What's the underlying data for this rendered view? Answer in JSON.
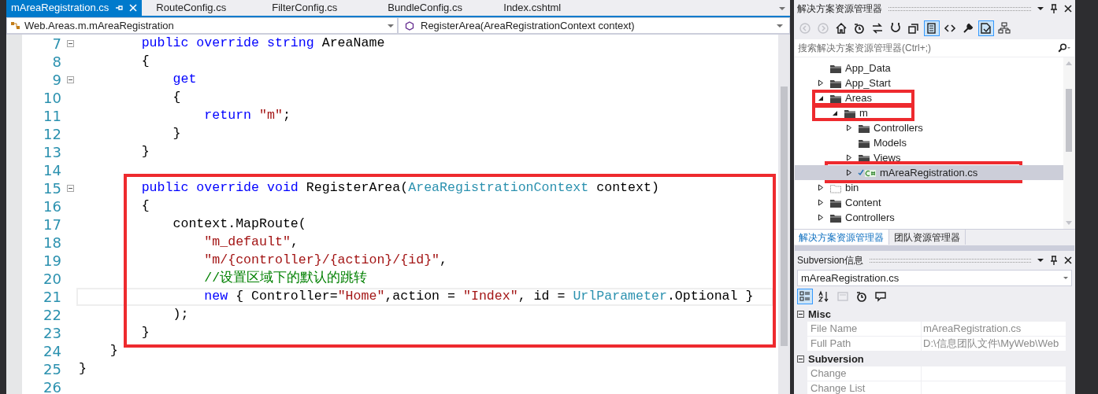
{
  "editor": {
    "tabs": [
      {
        "label": "mAreaRegistration.cs",
        "selected": true
      },
      {
        "label": "RouteConfig.cs",
        "selected": false
      },
      {
        "label": "FilterConfig.cs",
        "selected": false
      },
      {
        "label": "BundleConfig.cs",
        "selected": false
      },
      {
        "label": "Index.cshtml",
        "selected": false
      }
    ],
    "type_dropdown": "Web.Areas.m.mAreaRegistration",
    "member_dropdown": "RegisterArea(AreaRegistrationContext context)",
    "blocks": [
      {
        "highlighted": false,
        "lines": [
          {
            "number": "7",
            "fold": true,
            "current": false,
            "tokens": [
              {
                "kind": "keyword",
                "text": "        public override string "
              },
              {
                "kind": "plain",
                "text": "AreaName"
              }
            ]
          },
          {
            "number": "8",
            "fold": false,
            "current": false,
            "tokens": [
              {
                "kind": "plain",
                "text": "        {"
              }
            ]
          },
          {
            "number": "9",
            "fold": true,
            "current": false,
            "tokens": [
              {
                "kind": "keyword",
                "text": "            get"
              }
            ]
          },
          {
            "number": "10",
            "fold": false,
            "current": false,
            "tokens": [
              {
                "kind": "plain",
                "text": "            {"
              }
            ]
          },
          {
            "number": "11",
            "fold": false,
            "current": false,
            "tokens": [
              {
                "kind": "keyword",
                "text": "                return "
              },
              {
                "kind": "string",
                "text": "\"m\""
              },
              {
                "kind": "plain",
                "text": ";"
              }
            ]
          },
          {
            "number": "12",
            "fold": false,
            "current": false,
            "tokens": [
              {
                "kind": "plain",
                "text": "            }"
              }
            ]
          },
          {
            "number": "13",
            "fold": false,
            "current": false,
            "tokens": [
              {
                "kind": "plain",
                "text": "        }"
              }
            ]
          },
          {
            "number": "14",
            "fold": false,
            "current": false
          }
        ]
      },
      {
        "highlighted": true,
        "lines": [
          {
            "number": "15",
            "fold": true,
            "current": false,
            "tokens": [
              {
                "kind": "keyword",
                "text": "        public override void "
              },
              {
                "kind": "plain",
                "text": "RegisterArea("
              },
              {
                "kind": "type",
                "text": "AreaRegistrationContext"
              },
              {
                "kind": "plain",
                "text": " context)"
              }
            ]
          },
          {
            "number": "16",
            "fold": false,
            "current": false,
            "tokens": [
              {
                "kind": "plain",
                "text": "        {"
              }
            ]
          },
          {
            "number": "17",
            "fold": false,
            "current": false,
            "tokens": [
              {
                "kind": "plain",
                "text": "            context.MapRoute("
              }
            ]
          },
          {
            "number": "18",
            "fold": false,
            "current": false,
            "tokens": [
              {
                "kind": "string",
                "text": "                \"m_default\""
              },
              {
                "kind": "plain",
                "text": ","
              }
            ]
          },
          {
            "number": "19",
            "fold": false,
            "current": false,
            "tokens": [
              {
                "kind": "string",
                "text": "                \"m/{controller}/{action}/{id}\""
              },
              {
                "kind": "plain",
                "text": ","
              }
            ]
          },
          {
            "number": "20",
            "fold": false,
            "current": false,
            "tokens": [
              {
                "kind": "comment",
                "text": "                //设置区域下的默认的跳转"
              }
            ]
          },
          {
            "number": "21",
            "fold": false,
            "current": true,
            "tokens": [
              {
                "kind": "keyword",
                "text": "                new"
              },
              {
                "kind": "plain",
                "text": " { Controller="
              },
              {
                "kind": "string",
                "text": "\"Home\""
              },
              {
                "kind": "plain",
                "text": ",action = "
              },
              {
                "kind": "string",
                "text": "\"Index\""
              },
              {
                "kind": "plain",
                "text": ", id = "
              },
              {
                "kind": "type",
                "text": "UrlParameter"
              },
              {
                "kind": "plain",
                "text": ".Optional }"
              }
            ]
          },
          {
            "number": "22",
            "fold": false,
            "current": false,
            "tokens": [
              {
                "kind": "plain",
                "text": "            );"
              }
            ]
          },
          {
            "number": "23",
            "fold": false,
            "current": false,
            "tokens": [
              {
                "kind": "plain",
                "text": "        }"
              }
            ]
          }
        ]
      },
      {
        "highlighted": false,
        "lines": [
          {
            "number": "24",
            "fold": false,
            "current": false,
            "tokens": [
              {
                "kind": "plain",
                "text": "    }"
              }
            ]
          },
          {
            "number": "25",
            "fold": false,
            "current": false,
            "tokens": [
              {
                "kind": "plain",
                "text": "}"
              }
            ]
          },
          {
            "number": "26",
            "fold": false,
            "current": false
          }
        ]
      }
    ]
  },
  "solution_explorer": {
    "title": "解决方案资源管理器",
    "toolbar": [
      {
        "kind": "back",
        "disabled": true,
        "pressed": false
      },
      {
        "kind": "forward",
        "disabled": true,
        "pressed": false
      },
      {
        "kind": "home",
        "disabled": false,
        "pressed": false
      },
      {
        "kind": "history",
        "disabled": false,
        "pressed": false
      },
      {
        "kind": "sync",
        "disabled": false,
        "pressed": false
      },
      {
        "kind": "refresh",
        "disabled": false,
        "pressed": false
      },
      {
        "kind": "collapse",
        "disabled": false,
        "pressed": false
      },
      {
        "kind": "show-all",
        "disabled": false,
        "pressed": true
      },
      {
        "kind": "code",
        "disabled": false,
        "pressed": false
      },
      {
        "kind": "properties",
        "disabled": false,
        "pressed": false
      },
      {
        "kind": "preview",
        "disabled": false,
        "pressed": true
      },
      {
        "kind": "diagram",
        "disabled": false,
        "pressed": false
      }
    ],
    "search": {
      "placeholder": "搜索解决方案资源管理器(Ctrl+;)"
    },
    "tree": [
      {
        "label": "App_Data",
        "kind": "folder",
        "highlighted": false,
        "selected": false
      },
      {
        "label": "App_Start",
        "kind": "folder",
        "expanded": false,
        "highlighted": false,
        "selected": false
      },
      {
        "label": "Areas",
        "kind": "folder",
        "expanded": true,
        "highlighted": true,
        "selected": false,
        "children": [
          {
            "label": "m",
            "kind": "folder",
            "expanded": true,
            "highlighted": true,
            "selected": false,
            "children": [
              {
                "label": "Controllers",
                "kind": "folder",
                "expanded": false,
                "highlighted": false,
                "selected": false
              },
              {
                "label": "Models",
                "kind": "folder",
                "highlighted": false,
                "selected": false
              },
              {
                "label": "Views",
                "kind": "folder",
                "expanded": false,
                "highlighted": false,
                "selected": false
              },
              {
                "label": "mAreaRegistration.cs",
                "kind": "csharp",
                "expanded": false,
                "highlighted": true,
                "selected": true
              }
            ]
          }
        ]
      },
      {
        "label": "bin",
        "kind": "hidden-folder",
        "expanded": false,
        "highlighted": false,
        "selected": false
      },
      {
        "label": "Content",
        "kind": "folder",
        "expanded": false,
        "highlighted": false,
        "selected": false
      },
      {
        "label": "Controllers",
        "kind": "folder",
        "expanded": false,
        "highlighted": false,
        "selected": false
      }
    ],
    "bottom_tabs": [
      {
        "label": "解决方案资源管理器",
        "selected": true
      },
      {
        "label": "团队资源管理器",
        "selected": false
      }
    ]
  },
  "subversion_panel": {
    "title": "Subversion信息",
    "file_dropdown": "mAreaRegistration.cs",
    "toolbar": [
      {
        "kind": "categorized",
        "disabled": false,
        "pressed": true
      },
      {
        "kind": "alphabetical",
        "disabled": false,
        "pressed": false
      },
      {
        "kind": "pages",
        "disabled": true,
        "pressed": false
      },
      {
        "kind": "history",
        "disabled": false,
        "pressed": false
      },
      {
        "kind": "comment",
        "disabled": false,
        "pressed": false
      }
    ],
    "categories": [
      {
        "name": "Misc",
        "expanded": true,
        "rows": [
          {
            "name": "File Name",
            "value": "mAreaRegistration.cs"
          },
          {
            "name": "Full Path",
            "value": "D:\\信息团队文件\\MyWeb\\Web"
          }
        ]
      },
      {
        "name": "Subversion",
        "expanded": true,
        "rows": [
          {
            "name": "Change"
          },
          {
            "name": "Change List"
          }
        ]
      }
    ]
  }
}
